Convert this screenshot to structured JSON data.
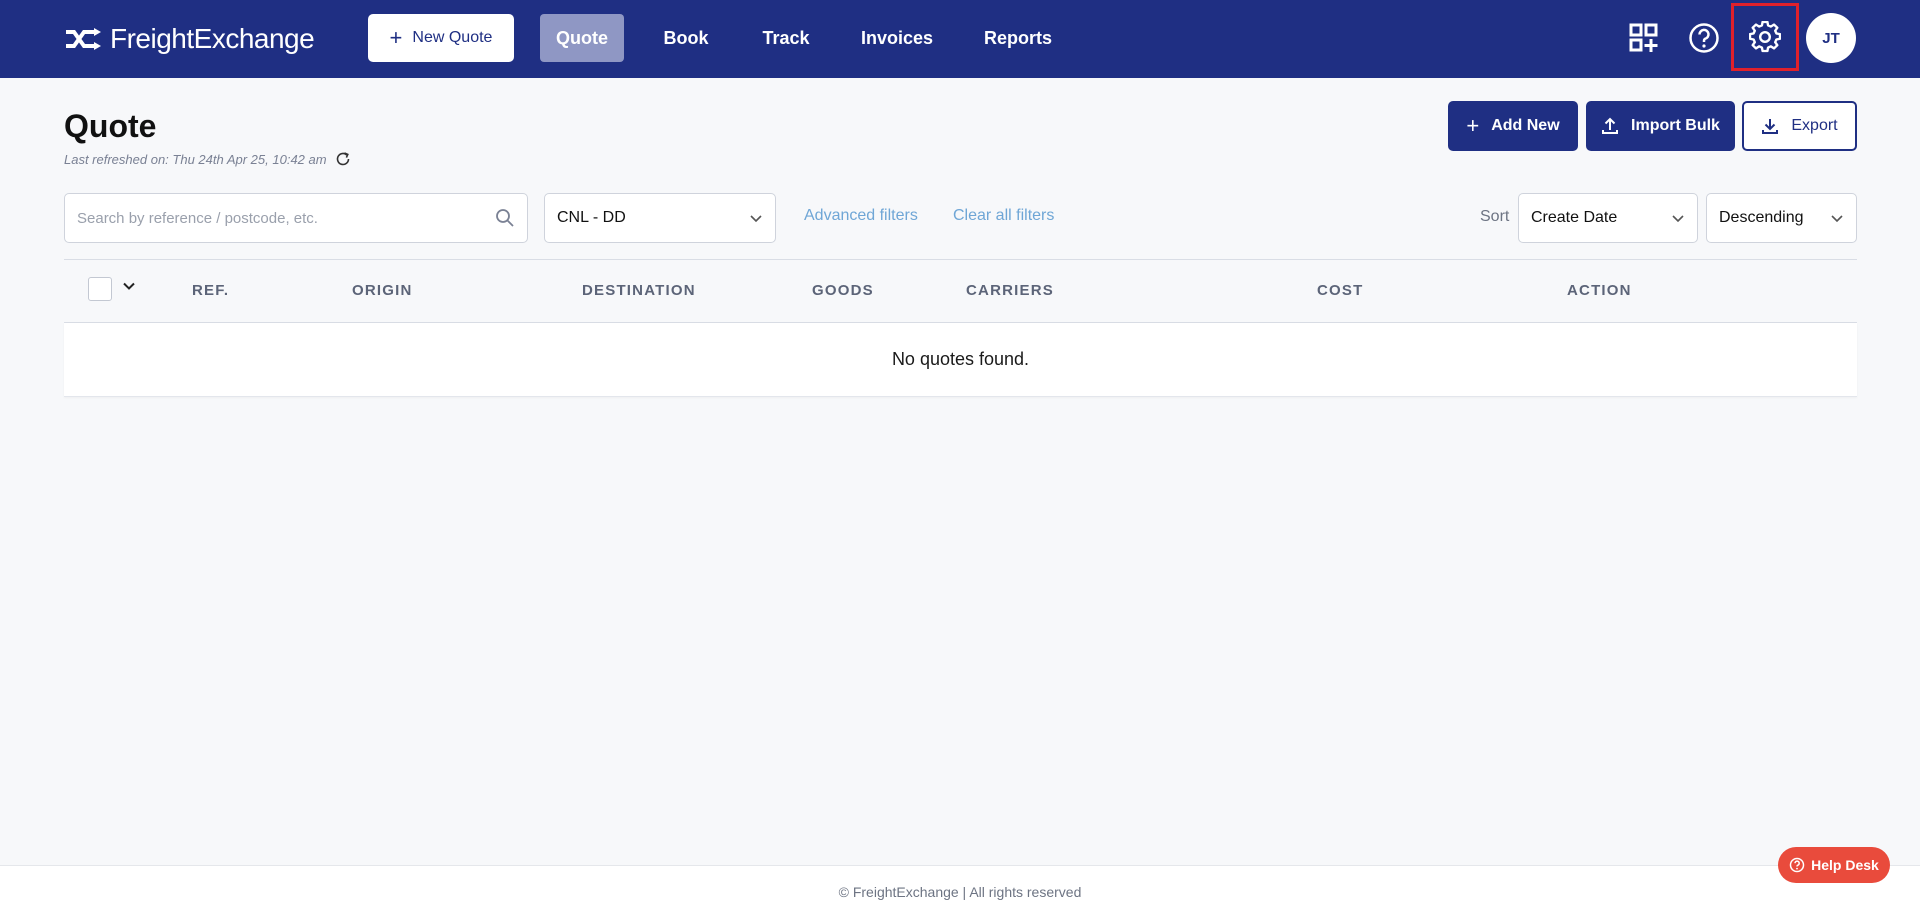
{
  "brand": {
    "name": "FreightExchange"
  },
  "header": {
    "new_quote_label": "New Quote",
    "nav": [
      "Quote",
      "Book",
      "Track",
      "Invoices",
      "Reports"
    ],
    "active_nav": "Quote",
    "avatar_initials": "JT",
    "icons": [
      "apps-add-icon",
      "help-circle-icon",
      "gear-icon"
    ],
    "colors": {
      "header_bg": "#1f2f83",
      "active_tab": "#8f97c4",
      "highlight": "#e0212b"
    }
  },
  "page": {
    "title": "Quote",
    "refreshed": "Last refreshed on: Thu 24th Apr 25, 10:42 am",
    "actions": {
      "add_new": "Add New",
      "import_bulk": "Import Bulk",
      "export": "Export"
    }
  },
  "filters": {
    "search_placeholder": "Search by reference / postcode, etc.",
    "search_value": "",
    "location_selected": "CNL - DD",
    "advanced": "Advanced filters",
    "clear": "Clear all filters",
    "sort_label": "Sort",
    "sort_by": "Create Date",
    "sort_order": "Descending"
  },
  "table": {
    "columns": [
      "REF.",
      "ORIGIN",
      "DESTINATION",
      "GOODS",
      "CARRIERS",
      "COST",
      "ACTION"
    ],
    "empty_message": "No quotes found."
  },
  "footer": {
    "text": "© FreightExchange | All rights reserved",
    "help_desk": "Help Desk"
  }
}
